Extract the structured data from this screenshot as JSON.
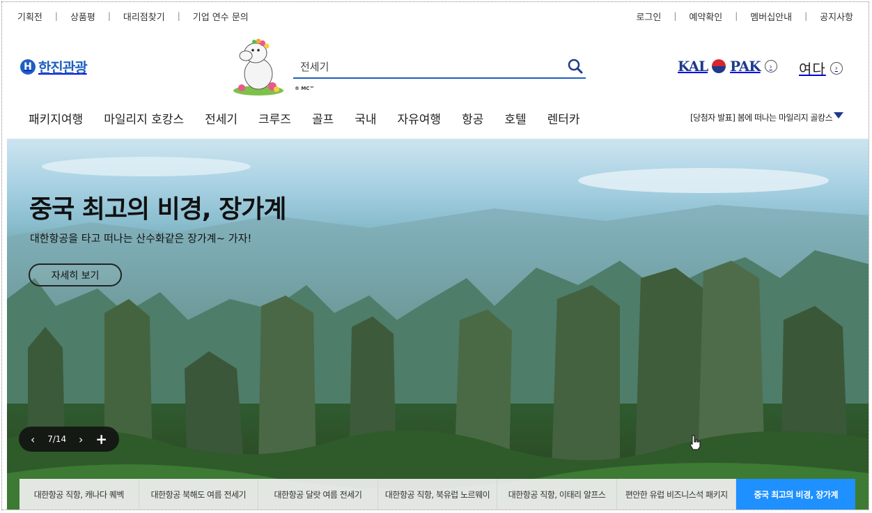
{
  "util_left": [
    "기획전",
    "상품평",
    "대리점찾기",
    "기업 연수 문의"
  ],
  "util_right": [
    "로그인",
    "예약확인",
    "멤버십안내",
    "공지사항"
  ],
  "logo": {
    "mark": "H",
    "text": "한진관광"
  },
  "mascot_tm": "® MC™",
  "search": {
    "value": "전세기",
    "icon": "search-icon"
  },
  "partners": {
    "kalpak_left": "KAL",
    "kalpak_right": "PAK",
    "yeoda": "여다"
  },
  "gnb": [
    "패키지여행",
    "마일리지 호캉스",
    "전세기",
    "크루즈",
    "골프",
    "국내",
    "자유여행",
    "항공",
    "호텔",
    "렌터카"
  ],
  "notice": "[당첨자 발표] 봄에 떠나는 마일리지 골캉스",
  "hero": {
    "title": "중국 최고의 비경, 장가계",
    "subtitle": "대한항공을 타고 떠나는 산수화같은 장가계~ 가자!",
    "button": "자세히 보기"
  },
  "pager": {
    "current": "7/14",
    "prev": "‹",
    "next": "›",
    "add": "+"
  },
  "tabs": [
    "대한항공 직항, 캐나다 퀘벡",
    "대한항공 북해도 여름 전세기",
    "대한항공 달랏 여름 전세기",
    "대한항공 직항, 북유럽 노르웨이",
    "대한항공 직항, 이태리 알프스",
    "편안한 유럽 비즈니스석 패키지",
    "중국 최고의 비경, 장가계"
  ],
  "active_tab_index": 6,
  "colors": {
    "brand": "#1f5fbf",
    "accent": "#1e90ff",
    "kal": "#1e3a8a"
  }
}
